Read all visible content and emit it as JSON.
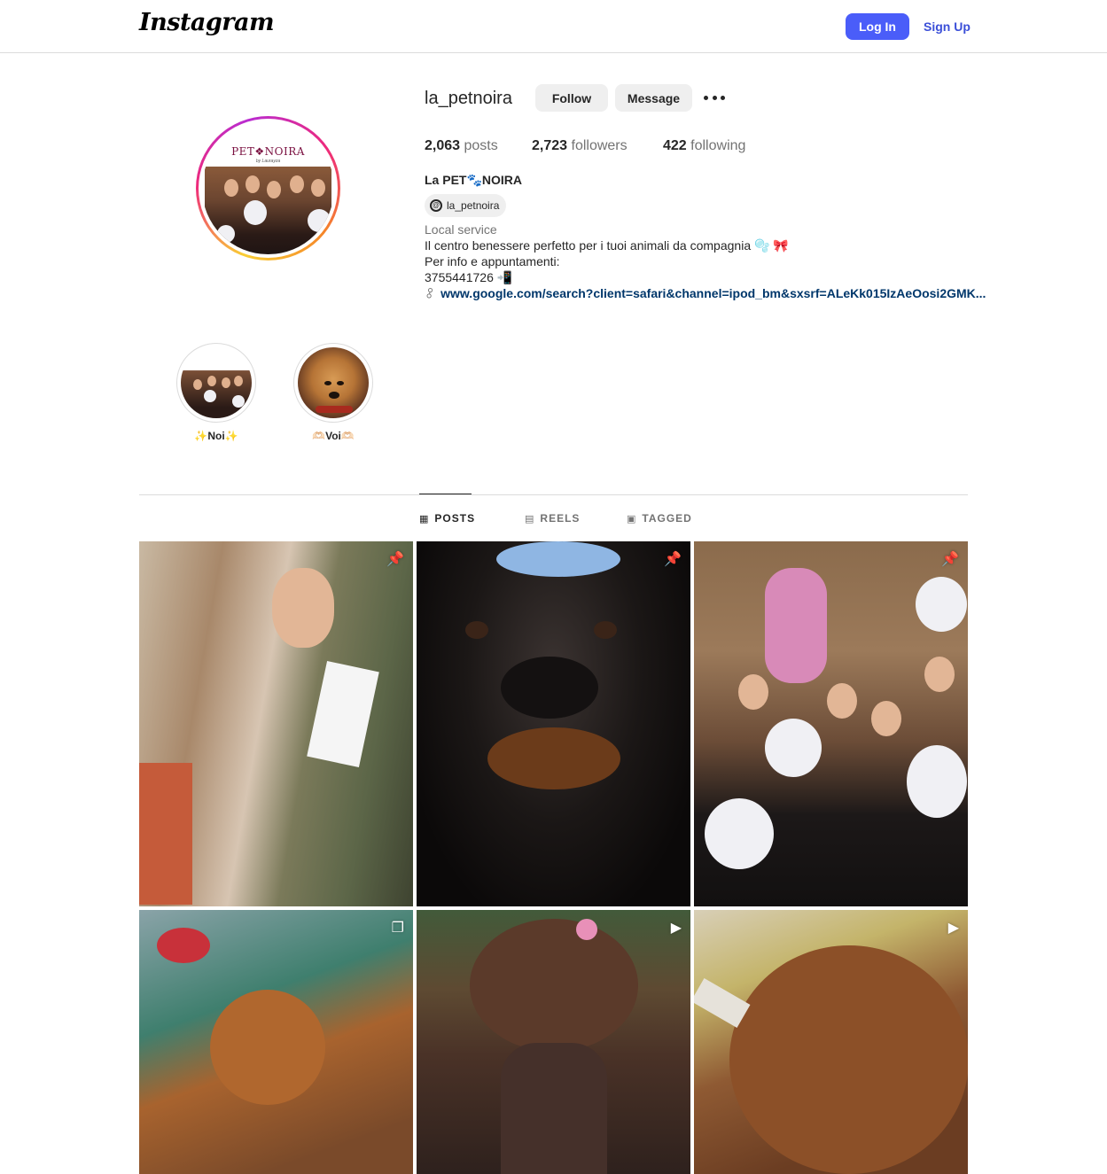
{
  "header": {
    "logo": "Instagram",
    "login_label": "Log In",
    "signup_label": "Sign Up",
    "accent_color": "#4a5df9"
  },
  "avatar": {
    "brand": "PET❖NOIRA",
    "sub": "by Laurayza"
  },
  "profile": {
    "username": "la_petnoira",
    "follow_label": "Follow",
    "message_label": "Message",
    "posts_count": "2,063",
    "posts_label": "posts",
    "followers_count": "2,723",
    "followers_label": "followers",
    "following_count": "422",
    "following_label": "following",
    "full_name": "La PET🐾NOIRA",
    "threads_handle": "la_petnoira",
    "category": "Local service",
    "bio_line_1": "Il centro benessere perfetto per i tuoi animali da compagnia 🫧 🎀",
    "bio_line_2": "Per info e appuntamenti:",
    "bio_line_3": "3755441726 📲",
    "link": "www.google.com/search?client=safari&channel=ipod_bm&sxsrf=ALeKk015IzAeOosi2GMK..."
  },
  "highlights": [
    {
      "label": "✨Noi✨"
    },
    {
      "label": "🫶🏻Voi🫶🏻"
    }
  ],
  "tabs": [
    {
      "label": "POSTS",
      "icon": "grid-icon",
      "active": true
    },
    {
      "label": "REELS",
      "icon": "reels-icon",
      "active": false
    },
    {
      "label": "TAGGED",
      "icon": "tagged-icon",
      "active": false
    }
  ],
  "posts": [
    {
      "badge": "pinned-icon",
      "glyph": "📌"
    },
    {
      "badge": "pinned-icon",
      "glyph": "📌"
    },
    {
      "badge": "pinned-icon",
      "glyph": "📌"
    },
    {
      "badge": "carousel-icon",
      "glyph": "❐"
    },
    {
      "badge": "reel-icon",
      "glyph": "▶"
    },
    {
      "badge": "reel-icon",
      "glyph": "▶"
    }
  ]
}
